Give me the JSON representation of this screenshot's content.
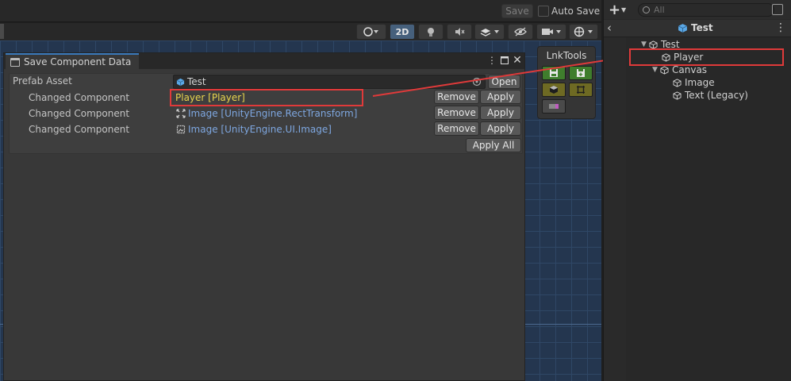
{
  "toolbar": {
    "save_label": "Save",
    "autosave_label": "Auto Save",
    "mode_2d_label": "2D"
  },
  "window": {
    "tab_title": "Save Component Data"
  },
  "panel": {
    "prefab_label": "Prefab Asset",
    "prefab_value": "Test",
    "open_label": "Open",
    "rows": [
      {
        "label": "Changed Component",
        "component": "Player [Player]",
        "remove": "Remove",
        "apply": "Apply"
      },
      {
        "label": "Changed Component",
        "component": "Image [UnityEngine.RectTransform]",
        "remove": "Remove",
        "apply": "Apply"
      },
      {
        "label": "Changed Component",
        "component": "Image [UnityEngine.UI.Image]",
        "remove": "Remove",
        "apply": "Apply"
      }
    ],
    "apply_all_label": "Apply All"
  },
  "lnktools": {
    "title": "LnkTools"
  },
  "hierarchy": {
    "search_placeholder": "All",
    "scene_title": "Test",
    "items": [
      {
        "label": "Test"
      },
      {
        "label": "Player"
      },
      {
        "label": "Canvas"
      },
      {
        "label": "Image"
      },
      {
        "label": "Text (Legacy)"
      }
    ]
  },
  "colors": {
    "highlight": "#e03a3a",
    "component_yellow": "#e8d44d",
    "component_blue": "#7ea7e0",
    "accent_blue": "#3a79bb"
  }
}
